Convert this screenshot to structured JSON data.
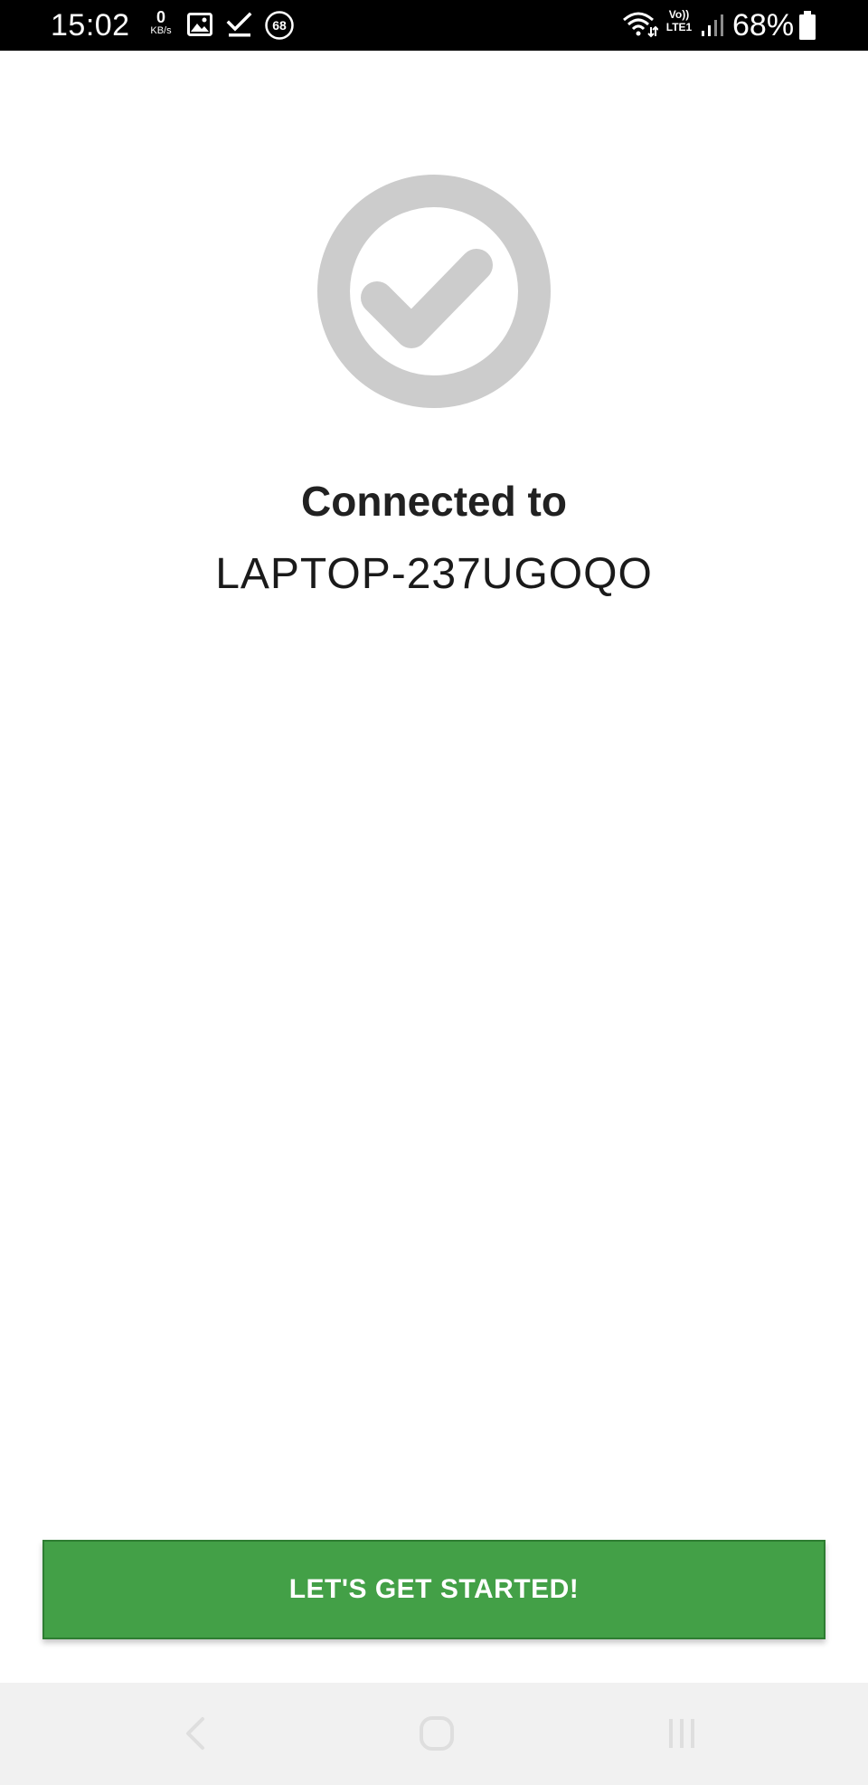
{
  "status_bar": {
    "time": "15:02",
    "data_speed_value": "0",
    "data_speed_unit": "KB/s",
    "notification_badge": "68",
    "volte_top": "Vo))",
    "volte_bottom": "LTE1",
    "battery_percent": "68%",
    "icons": [
      "gallery-icon",
      "download-done-icon",
      "notification-count-icon",
      "wifi-icon",
      "volte-icon",
      "signal-icon",
      "battery-icon"
    ]
  },
  "main": {
    "status_icon": "check-circle-icon",
    "title": "Connected to",
    "device_name": "LAPTOP-237UGOQO",
    "button_label": "LET'S GET STARTED!"
  },
  "navigation_bar": {
    "icons": [
      "back-icon",
      "home-icon",
      "recents-icon"
    ]
  },
  "colors": {
    "status_bar_bg": "#000000",
    "icon_gray": "#cccccc",
    "button_green": "#43a047",
    "nav_bar_bg": "#f1f1f1"
  }
}
